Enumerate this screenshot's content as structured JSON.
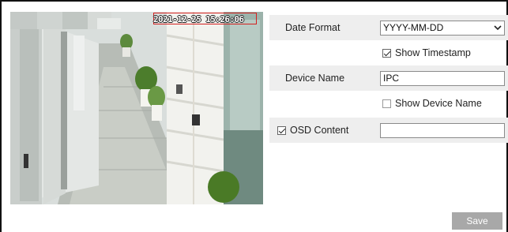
{
  "preview": {
    "osd_timestamp": "2021-12-25 15:26:06"
  },
  "settings": {
    "date_format": {
      "label": "Date Format",
      "selected": "YYYY-MM-DD"
    },
    "show_timestamp": {
      "label": "Show Timestamp",
      "checked": true
    },
    "device_name": {
      "label": "Device Name",
      "value": "IPC"
    },
    "show_device_name": {
      "label": "Show Device Name",
      "checked": false
    },
    "osd_content": {
      "label": "OSD Content",
      "checked": true,
      "value": ""
    }
  },
  "actions": {
    "save_label": "Save"
  },
  "colors": {
    "osd_box": "#d42020",
    "save_button": "#a8a8a8",
    "row_shade": "#eeeeee"
  }
}
